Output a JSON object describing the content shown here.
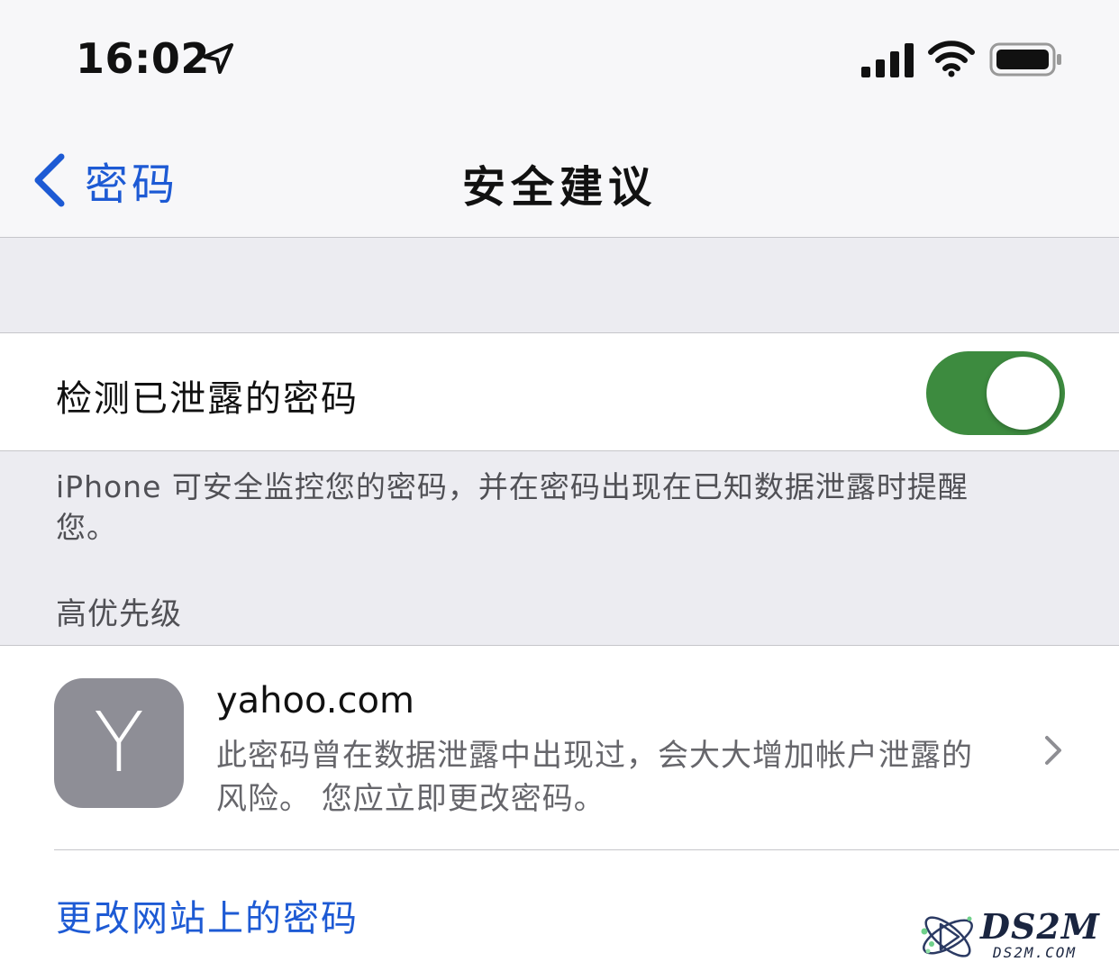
{
  "status_bar": {
    "time": "16:02",
    "icons": [
      "location-arrow-icon",
      "cellular-signal-icon",
      "wifi-icon",
      "battery-icon"
    ]
  },
  "nav": {
    "back_label": "密码",
    "title": "安全建议"
  },
  "toggle": {
    "label": "检测已泄露的密码",
    "on": true
  },
  "footer_note": "iPhone 可安全监控您的密码，并在密码出现在已知数据泄露时提醒您。",
  "section_header": "高优先级",
  "site": {
    "avatar_letter": "Y",
    "name": "yahoo.com",
    "description": "此密码曾在数据泄露中出现过，会大大增加帐户泄露的风险。 您应立即更改密码。"
  },
  "change_link": "更改网站上的密码",
  "watermark": {
    "text": "DS2M",
    "subtext": "DS2M.COM"
  },
  "colors": {
    "accent": "#1d5ad4",
    "switch_on": "#3d8b3f",
    "grouped_background": "#ececf1"
  }
}
